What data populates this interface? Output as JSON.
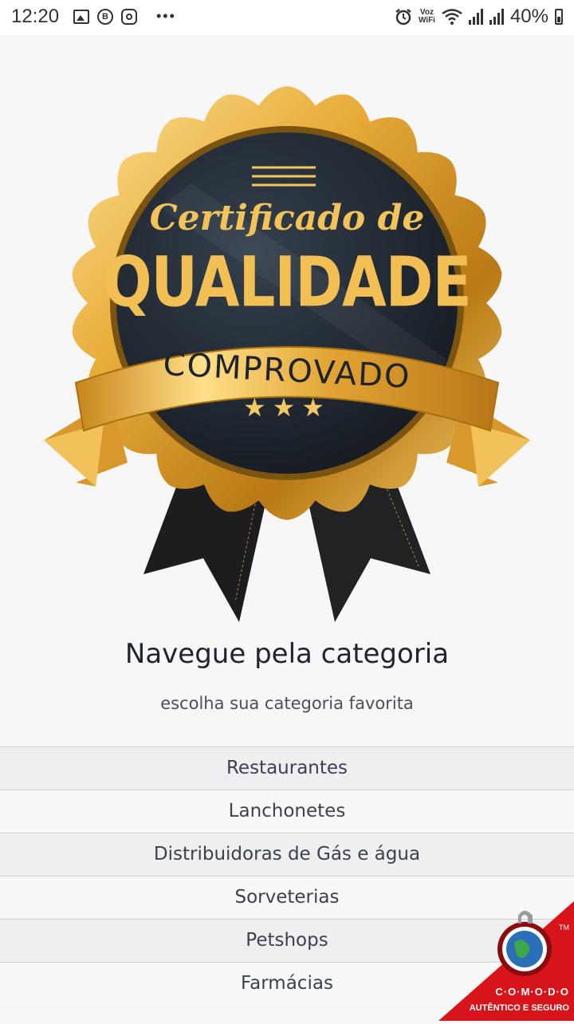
{
  "status_bar": {
    "time": "12:20",
    "icons_left": [
      "image-icon",
      "b-app-icon",
      "instagram-icon",
      "more-dots-icon"
    ],
    "voz_label": "Voz",
    "wifi_label": "WiFi",
    "battery": "40%"
  },
  "badge": {
    "line1": "Certificado de",
    "line2": "QUALIDADE",
    "ribbon": "COMPROVADO",
    "stars": "★★★"
  },
  "heading": {
    "title": "Navegue pela categoria",
    "subtitle": "escolha sua categoria favorita"
  },
  "categories": [
    {
      "label": "Restaurantes"
    },
    {
      "label": "Lanchonetes"
    },
    {
      "label": "Distribuidoras de Gás e água"
    },
    {
      "label": "Sorveterias"
    },
    {
      "label": "Petshops"
    },
    {
      "label": "Farmácias"
    }
  ],
  "comodo": {
    "name": "C·O·M·O·D·O",
    "tagline": "AUTÊNTICO E SEGURO",
    "tm": "TM"
  },
  "colors": {
    "gold": "#e3a72f",
    "dark_badge": "#1c2027",
    "comodo_red": "#d8141b"
  }
}
